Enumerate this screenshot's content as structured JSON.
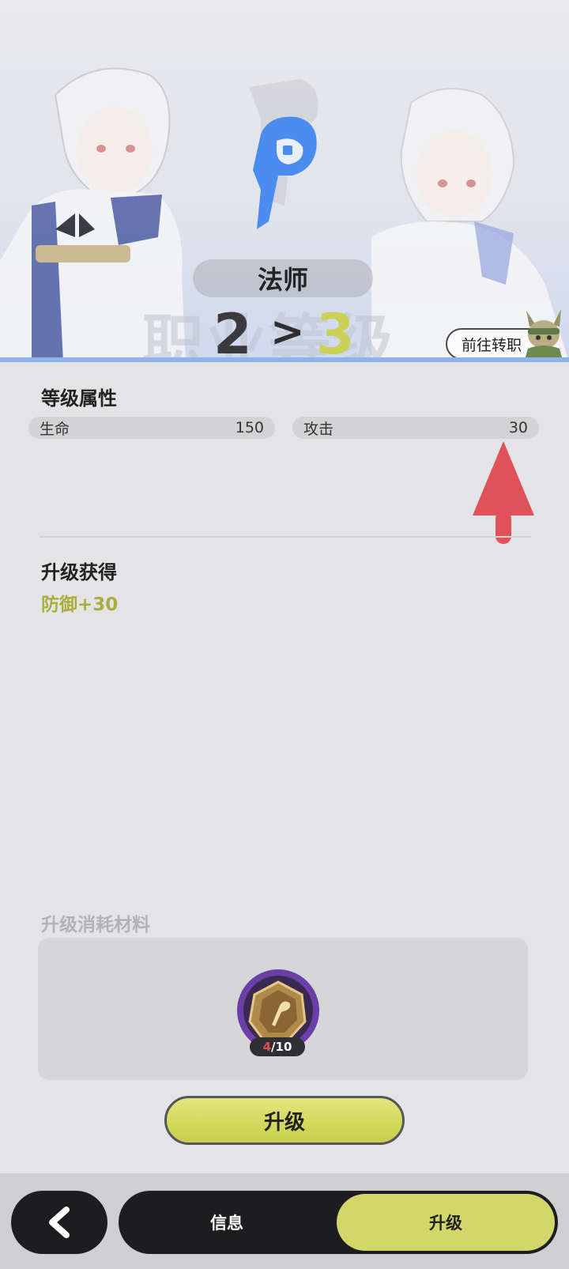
{
  "hero": {
    "class_name": "法师",
    "watermark": "职业等级",
    "level_from": "2",
    "level_arrow": ">",
    "level_to": "3",
    "goto_button": "前往转职"
  },
  "attributes": {
    "title": "等级属性",
    "stats": [
      {
        "label": "生命",
        "value": "150"
      },
      {
        "label": "攻击",
        "value": "30"
      }
    ]
  },
  "rewards": {
    "title": "升级获得",
    "gain": "防御+30"
  },
  "materials": {
    "title": "升级消耗材料",
    "item": {
      "icon": "staff-emblem-icon",
      "current": "4",
      "separator": "/",
      "required": "10"
    }
  },
  "actions": {
    "upgrade_button": "升级"
  },
  "nav": {
    "back_icon": "chevron-left-icon",
    "tabs": [
      {
        "label": "信息",
        "active": false
      },
      {
        "label": "升级",
        "active": true
      }
    ]
  },
  "colors": {
    "accent_yellow": "#d3d76a",
    "gain_green": "#a9ae3c",
    "arrow_red": "#e0525a",
    "staff_blue": "#4a8cf0",
    "material_purple": "#6a3fa8"
  }
}
